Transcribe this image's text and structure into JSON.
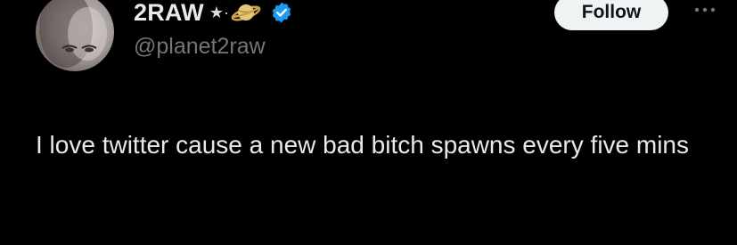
{
  "tweet": {
    "author": {
      "display_name": "2RAW",
      "decorations": "★·",
      "decoration_icon": "saturn-planet-emoji",
      "verified_icon": "verified-badge-icon",
      "verified_color": "#1d9bf0",
      "handle": "@planet2raw",
      "avatar_icon": "profile-avatar"
    },
    "follow_label": "Follow",
    "more_icon": "more-options-icon",
    "text": "I love twitter cause a new bad bitch spawns every five mins"
  },
  "colors": {
    "background": "#000000",
    "primary_text": "#e7e9ea",
    "secondary_text": "#71767b",
    "follow_bg": "#eff3f4",
    "follow_text": "#0f1419"
  }
}
